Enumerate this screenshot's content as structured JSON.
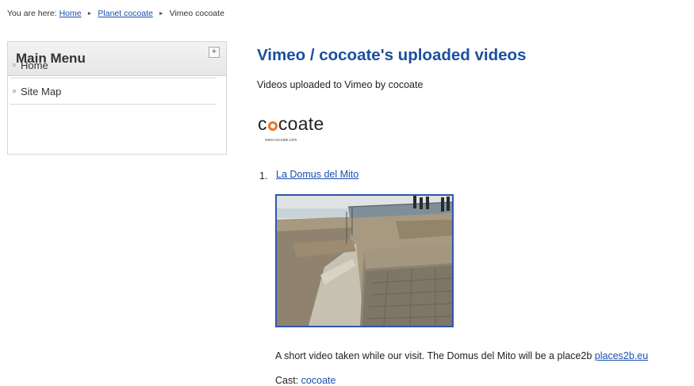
{
  "breadcrumb": {
    "prefix": "You are here:",
    "items": [
      "Home",
      "Planet cocoate",
      "Vimeo cocoate"
    ]
  },
  "sidebar": {
    "title": "Main Menu",
    "toggle": "+",
    "items": [
      {
        "label": "Home"
      },
      {
        "label": "Site Map"
      }
    ]
  },
  "main": {
    "title": "Vimeo / cocoate's uploaded videos",
    "subtitle": "Videos uploaded to Vimeo by cocoate",
    "logo": {
      "text_before": "c",
      "text_after": "coate",
      "url": "www.cocoate.com"
    },
    "videos": [
      {
        "number": "1.",
        "title": "La Domus del Mito",
        "description": "A short video taken while our visit. The Domus del Mito will be a place2b",
        "description_link": "places2b.eu",
        "cast_label": "Cast:",
        "cast_name": "cocoate"
      }
    ]
  },
  "colors": {
    "link": "#1a4fb0",
    "title": "#1d4fa0",
    "logo_accent": "#e87722",
    "thumb_border": "#2f57b0"
  }
}
